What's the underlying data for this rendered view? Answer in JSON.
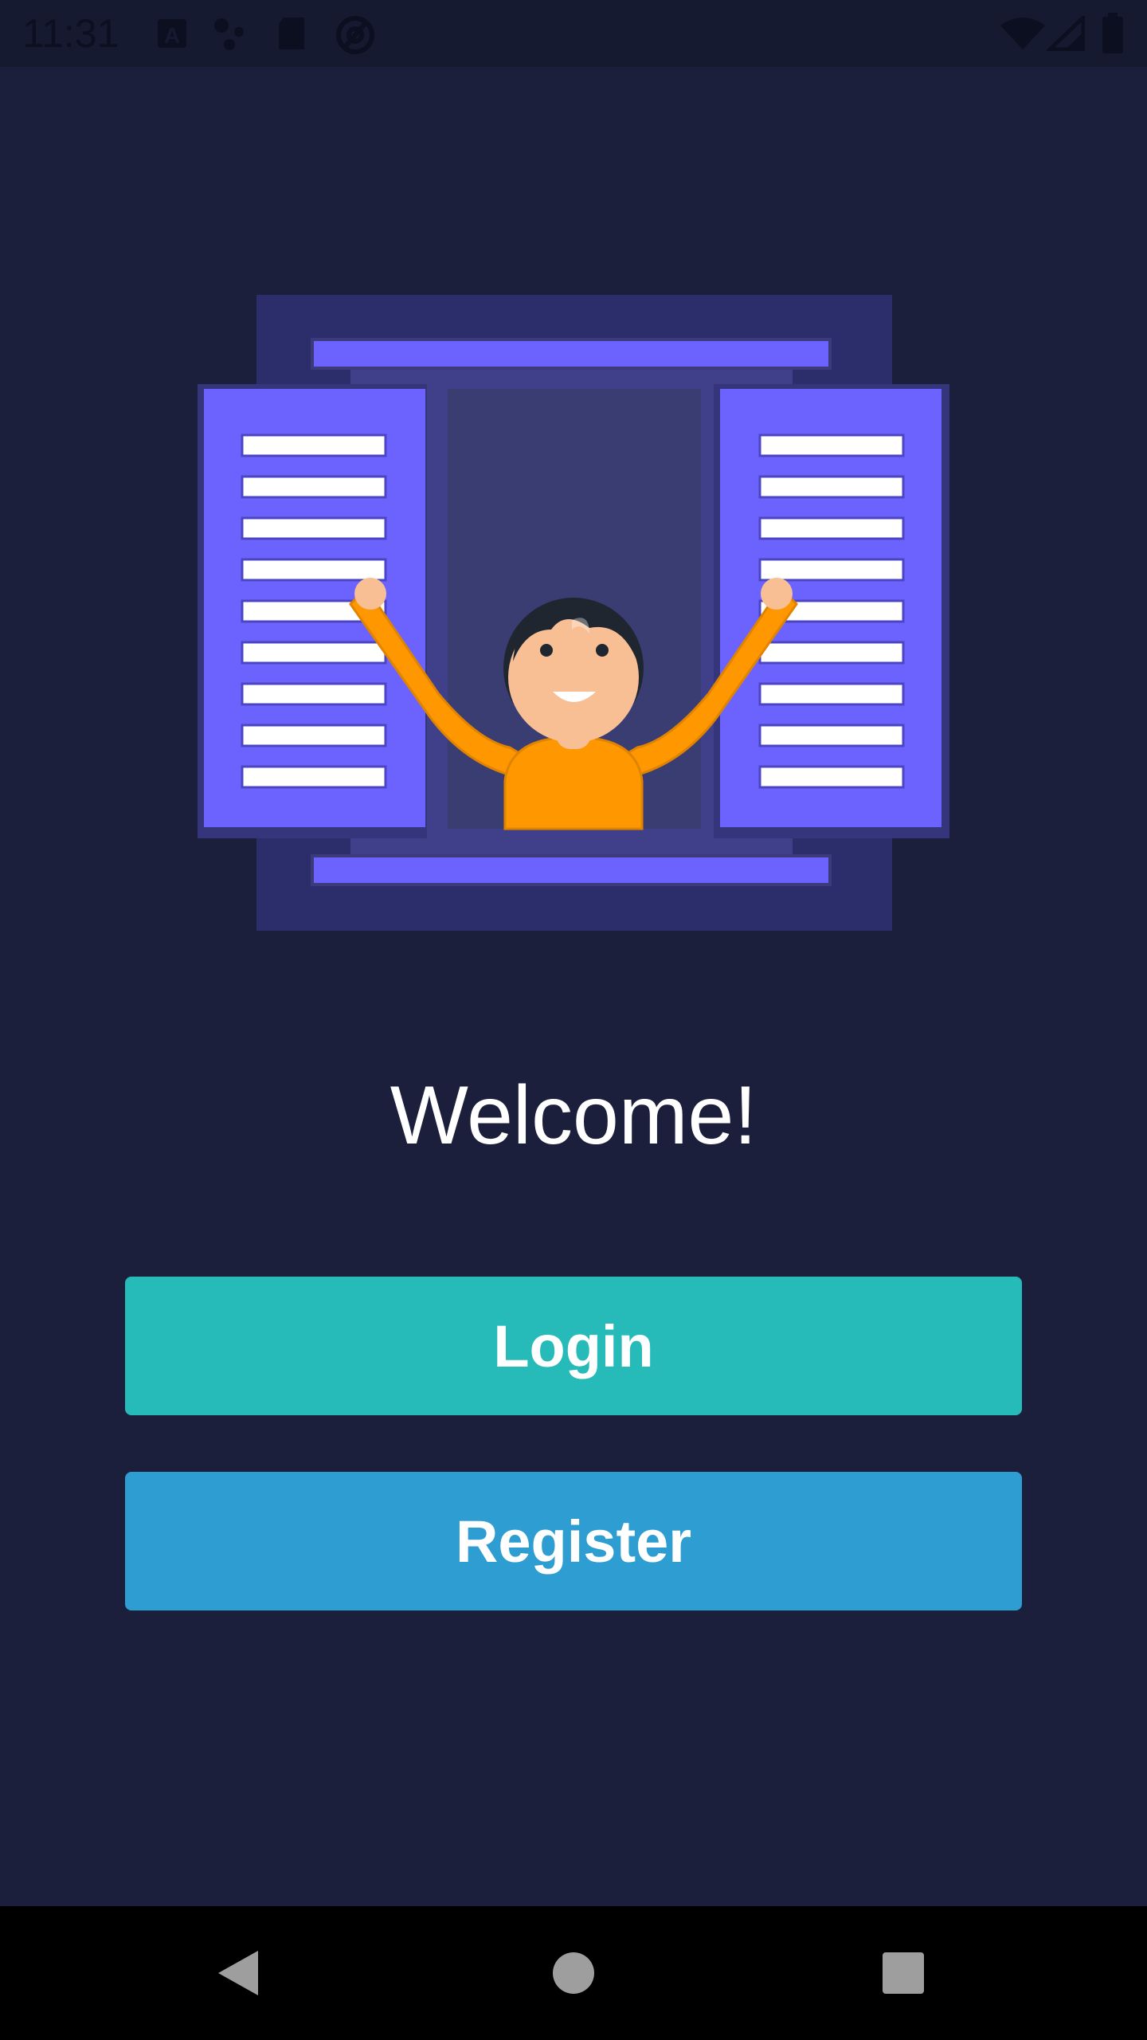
{
  "status_bar": {
    "time": "11:31",
    "left_icons": [
      "font-a-icon",
      "assistant-dots-icon",
      "sd-card-icon",
      "at-sign-icon"
    ],
    "right_icons": [
      "wifi-icon",
      "cell-signal-icon",
      "battery-icon"
    ]
  },
  "main": {
    "welcome_text": "Welcome!",
    "login_label": "Login",
    "register_label": "Register"
  },
  "nav_bar": {
    "icons": [
      "back-icon",
      "home-icon",
      "recents-icon"
    ]
  },
  "colors": {
    "background": "#1b1f3b",
    "status_bar": "#161a30",
    "login_button": "#26bbb9",
    "register_button": "#2e9dd1",
    "shutter": "#6c63ff",
    "window_frame": "#2c2d6b",
    "person_shirt": "#ff9800"
  }
}
